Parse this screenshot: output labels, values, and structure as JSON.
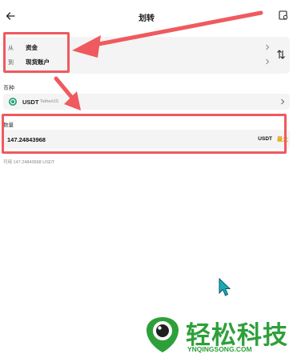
{
  "header": {
    "title": "划转",
    "back_icon": "back-arrow-icon",
    "history_icon": "transfer-history-icon"
  },
  "transfer": {
    "from_prefix": "从",
    "from_account": "资金",
    "to_prefix": "到",
    "to_account": "现货账户",
    "swap_icon": "swap-arrows-icon"
  },
  "coin": {
    "label": "币种",
    "symbol": "USDT",
    "full_name": "TetherUS",
    "icon": "tether-coin-icon"
  },
  "amount": {
    "label": "数量",
    "value": "147.24843968",
    "unit": "USDT",
    "max_label": "最大"
  },
  "available": {
    "text": "可用 147.24843968 USDT"
  },
  "watermark": {
    "title": "轻松科技",
    "url": "YNQINGSONG.COM"
  },
  "colors": {
    "annotation": "#ef5a5f",
    "accent": "#e0a100",
    "card_bg": "#f4f4f4",
    "coin_green": "#26a17b",
    "watermark_green": "#2ea03a",
    "cursor": "#1aa9b8"
  }
}
